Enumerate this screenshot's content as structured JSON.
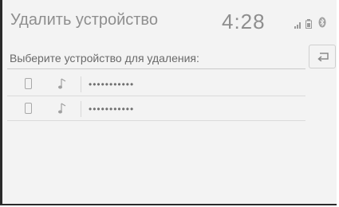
{
  "header": {
    "title": "Удалить устройство",
    "clock": "4:28",
    "icons": [
      "signal-icon",
      "battery-icon",
      "bluetooth-icon"
    ],
    "bluetooth_glyph": "ʙ"
  },
  "prompt": {
    "text": "Выберите устройство для удаления:"
  },
  "back_button": {
    "icon": "back-arrow-icon"
  },
  "devices": [
    {
      "name": "•••••••••••",
      "icons": [
        "phone-icon",
        "music-icon"
      ]
    },
    {
      "name": "•••••••••••",
      "icons": [
        "phone-icon",
        "music-icon"
      ]
    }
  ],
  "colors": {
    "background": "#f3f3f3",
    "text": "#8e8e8e",
    "border": "#2a2a2a"
  }
}
